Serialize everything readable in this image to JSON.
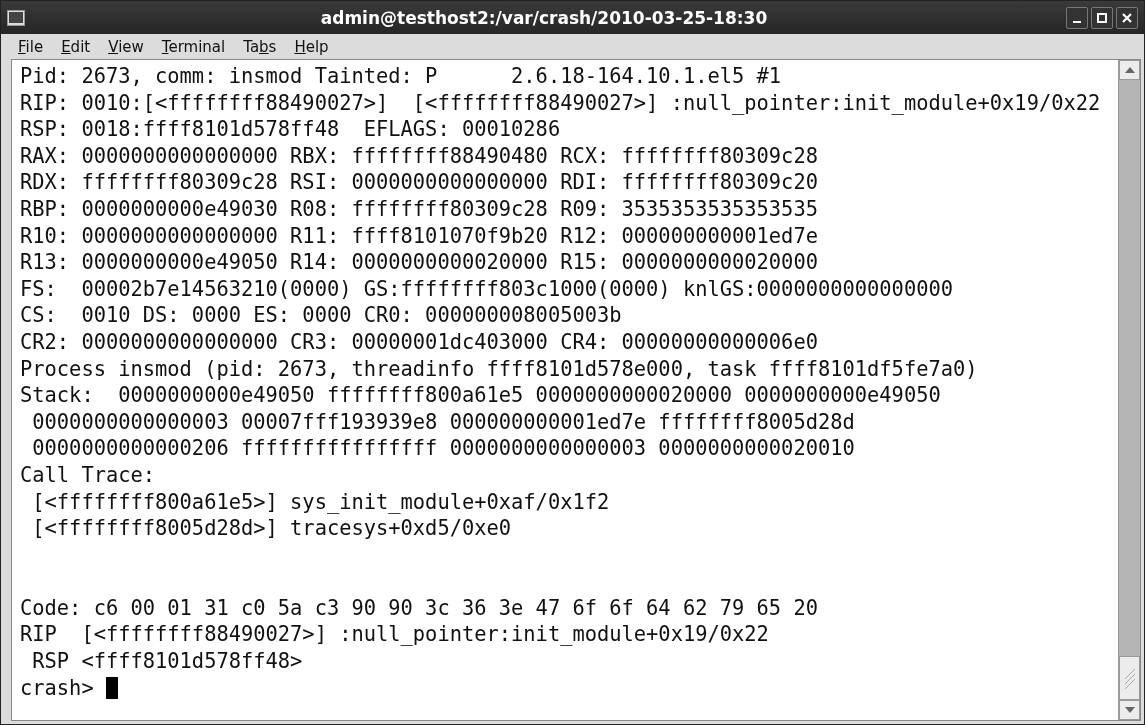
{
  "window": {
    "title": "admin@testhost2:/var/crash/2010-03-25-18:30"
  },
  "menu": [
    {
      "key": "F",
      "post": "ile"
    },
    {
      "key": "E",
      "post": "dit"
    },
    {
      "key": "V",
      "post": "iew"
    },
    {
      "key": "T",
      "post": "erminal"
    },
    {
      "pre": "Ta",
      "key": "b",
      "post": "s"
    },
    {
      "key": "H",
      "post": "elp"
    }
  ],
  "terminal": {
    "lines": [
      {
        "kind": "text",
        "text": "Pid: 2673, comm: insmod Tainted: P      2.6.18-164.10.1.el5 #1"
      },
      {
        "kind": "text",
        "text": "RIP: 0010:[<ffffffff88490027>]  [<ffffffff88490027>] :null_pointer:init_module+0x19/0x22"
      },
      {
        "kind": "text",
        "text": "RSP: 0018:ffff8101d578ff48  EFLAGS: 00010286"
      },
      {
        "kind": "text",
        "text": "RAX: 0000000000000000 RBX: ffffffff88490480 RCX: ffffffff80309c28"
      },
      {
        "kind": "text",
        "text": "RDX: ffffffff80309c28 RSI: 0000000000000000 RDI: ffffffff80309c20"
      },
      {
        "kind": "text",
        "text": "RBP: 0000000000e49030 R08: ffffffff80309c28 R09: 3535353535353535"
      },
      {
        "kind": "text",
        "text": "R10: 0000000000000000 R11: ffff8101070f9b20 R12: 000000000001ed7e"
      },
      {
        "kind": "text",
        "text": "R13: 0000000000e49050 R14: 0000000000020000 R15: 0000000000020000"
      },
      {
        "kind": "text",
        "text": "FS:  00002b7e14563210(0000) GS:ffffffff803c1000(0000) knlGS:0000000000000000"
      },
      {
        "kind": "text",
        "text": "CS:  0010 DS: 0000 ES: 0000 CR0: 000000008005003b"
      },
      {
        "kind": "text",
        "text": "CR2: 0000000000000000 CR3: 00000001dc403000 CR4: 00000000000006e0"
      },
      {
        "kind": "text",
        "text": "Process insmod (pid: 2673, threadinfo ffff8101d578e000, task ffff8101df5fe7a0)"
      },
      {
        "kind": "text",
        "text": "Stack:  0000000000e49050 ffffffff800a61e5 0000000000020000 0000000000e49050"
      },
      {
        "kind": "text",
        "text": " 0000000000000003 00007fff193939e8 000000000001ed7e ffffffff8005d28d"
      },
      {
        "kind": "text",
        "text": " 0000000000000206 ffffffffffffffff 0000000000000003 0000000000020010"
      },
      {
        "kind": "text",
        "text": "Call Trace:"
      },
      {
        "kind": "text",
        "text": " [<ffffffff800a61e5>] sys_init_module+0xaf/0x1f2"
      },
      {
        "kind": "text",
        "text": " [<ffffffff8005d28d>] tracesys+0xd5/0xe0"
      },
      {
        "kind": "blank"
      },
      {
        "kind": "blank"
      },
      {
        "kind": "text",
        "text": "Code: c6 00 01 31 c0 5a c3 90 90 3c 36 3e 47 6f 6f 64 62 79 65 20"
      },
      {
        "kind": "text",
        "text": "RIP  [<ffffffff88490027>] :null_pointer:init_module+0x19/0x22"
      },
      {
        "kind": "text",
        "text": " RSP <ffff8101d578ff48>"
      },
      {
        "kind": "prompt",
        "text": "crash>",
        "cursor": true
      }
    ]
  }
}
